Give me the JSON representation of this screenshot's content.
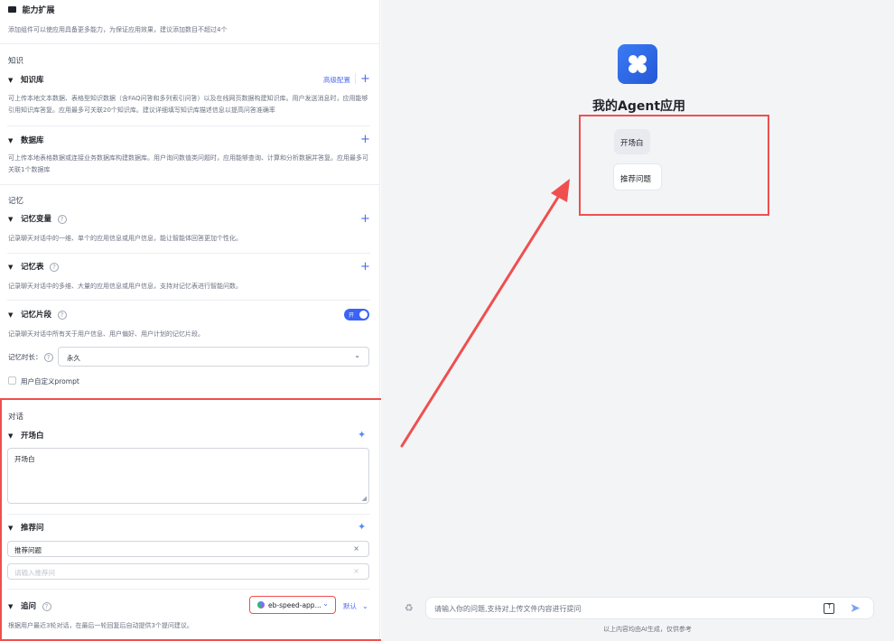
{
  "left": {
    "header": {
      "title": "能力扩展",
      "desc": "添加组件可以使应用具备更多能力，为保证应用效果，建议添加数目不超过4个"
    },
    "knowledge": {
      "section": "知识",
      "kb": {
        "title": "知识库",
        "advanced": "高级配置",
        "desc": "可上传本地文本数据、表格型知识数据（含FAQ问答和多列索引问答）以及在线网页数据构建知识库。用户发送消息时，应用能够引用知识库答复。应用最多可关联20个知识库。建议详细填写知识库描述信息以提高问答准确率"
      },
      "db": {
        "title": "数据库",
        "desc": "可上传本地表格数据或连接业务数据库构建数据库。用户询问数值类问题时，应用能够查询、计算和分析数据并答复。应用最多可关联1个数据库"
      }
    },
    "memory": {
      "section": "记忆",
      "variable": {
        "title": "记忆变量",
        "desc": "记录聊天对话中的一维、单个的应用信息或用户信息，能让智能体回答更加个性化。"
      },
      "table": {
        "title": "记忆表",
        "desc": "记录聊天对话中的多维、大量的应用信息或用户信息，支持对记忆表进行智能问数。"
      },
      "fragment": {
        "title": "记忆片段",
        "toggle_label": "开",
        "desc": "记录聊天对话中所有关于用户信息、用户偏好、用户计划的记忆片段。"
      },
      "duration_label": "记忆时长：",
      "duration_value": "永久",
      "custom_prompt": "用户自定义prompt"
    },
    "dialog": {
      "section": "对话",
      "opening": {
        "title": "开场白",
        "value": "开场白"
      },
      "suggest": {
        "title": "推荐问",
        "value1": "推荐问题",
        "placeholder": "请输入推荐问"
      },
      "followup": {
        "title": "追问",
        "model": "eb-speed-app...",
        "default": "默认",
        "desc": "根据用户最近3轮对话，在最后一轮回复后自动提供3个提问建议。"
      }
    }
  },
  "preview": {
    "app_name": "我的Agent应用",
    "opening_chip": "开场白",
    "suggest_chip": "推荐问题",
    "input_placeholder": "请输入你的问题,支持对上传文件内容进行提问",
    "footer_note": "以上内容均由AI生成，仅供参考"
  },
  "colors": {
    "accent": "#3b63f5",
    "annotation_red": "#ef4f4f"
  }
}
